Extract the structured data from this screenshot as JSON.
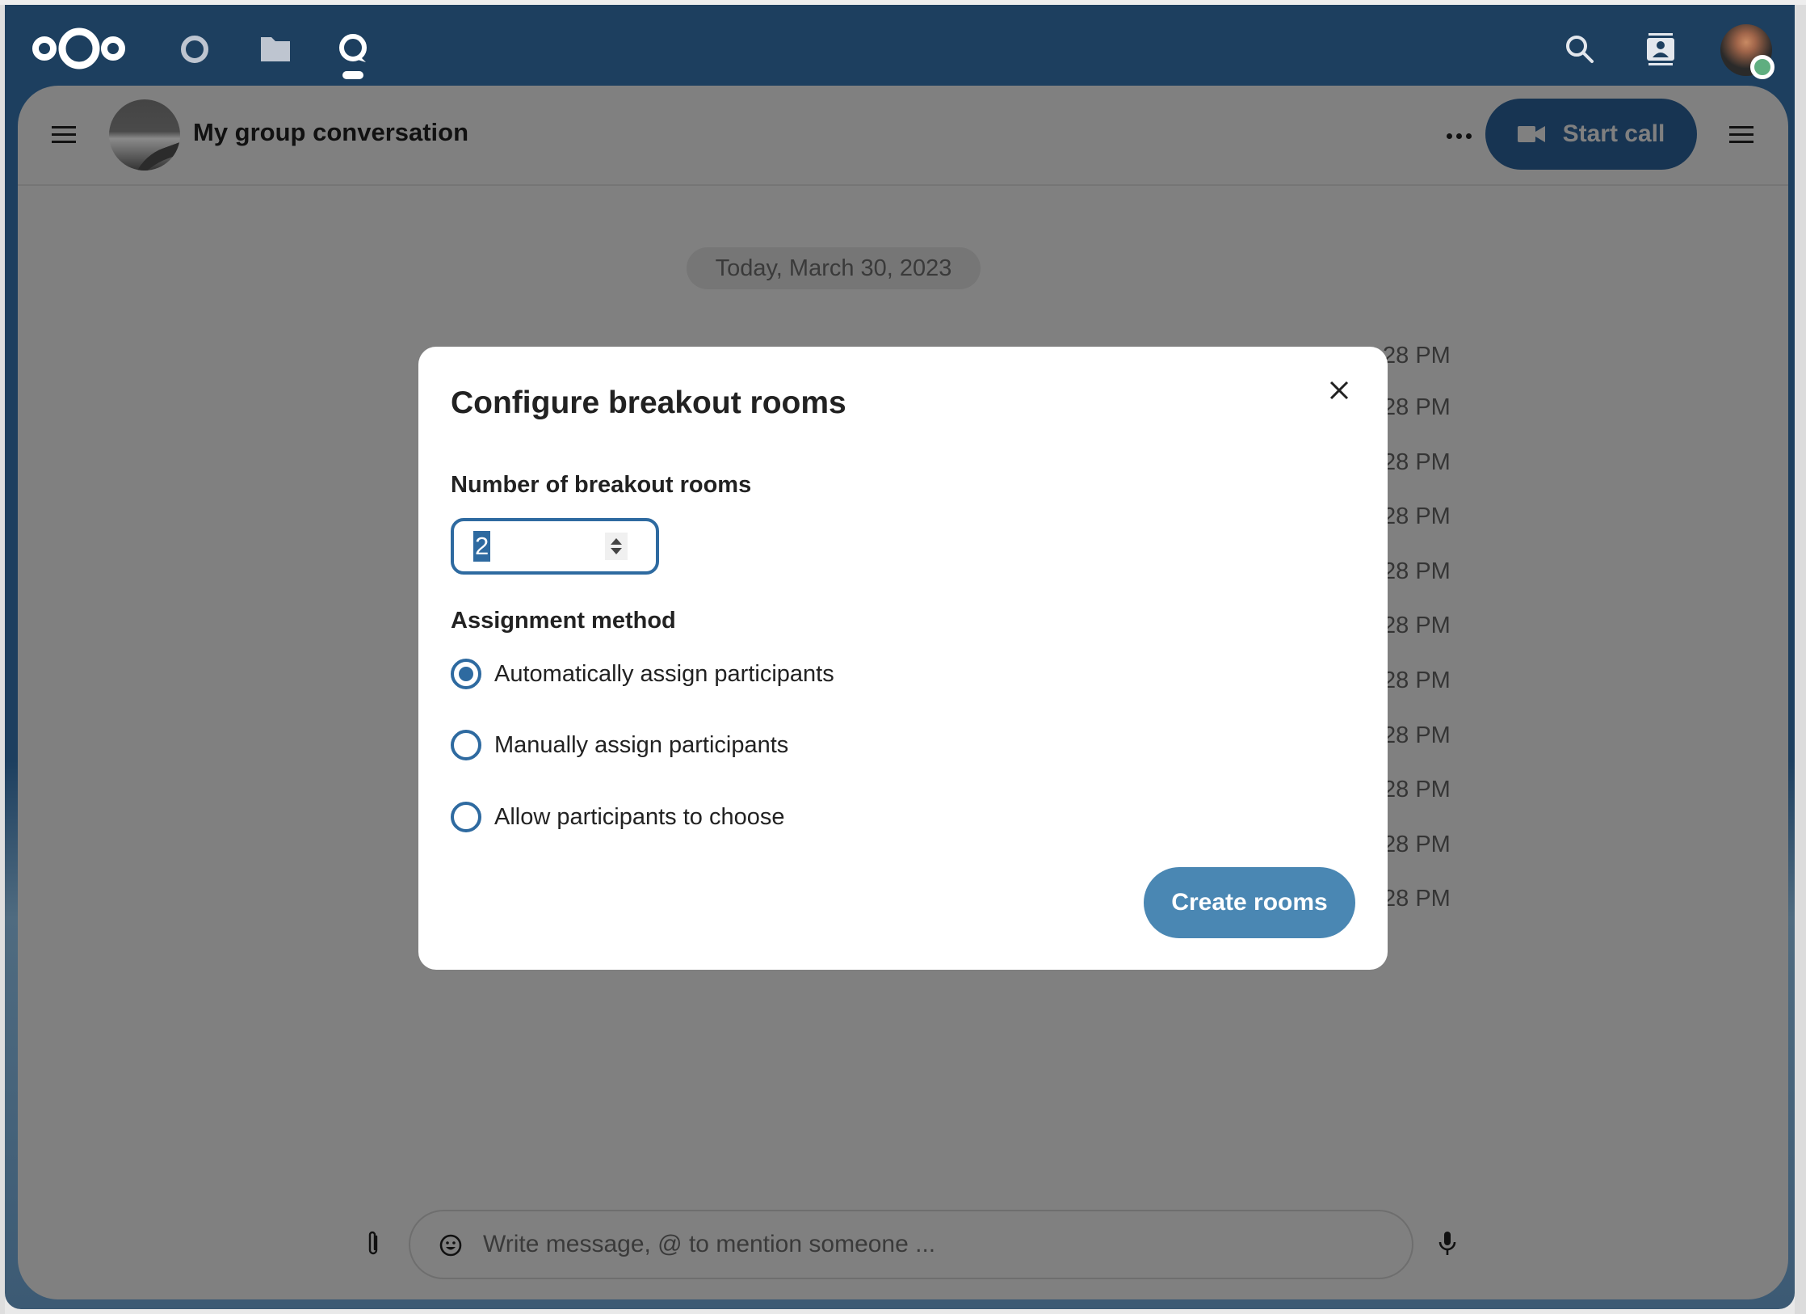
{
  "topbar": {
    "apps": [
      {
        "name": "dashboard",
        "icon": "circle-icon"
      },
      {
        "name": "files",
        "icon": "folder-icon"
      },
      {
        "name": "talk",
        "icon": "talk-icon",
        "active": true
      }
    ],
    "right": [
      {
        "name": "search",
        "icon": "search-icon"
      },
      {
        "name": "contacts",
        "icon": "contacts-icon"
      }
    ],
    "user_status": "online",
    "colors": {
      "header": "#1d3f5f",
      "status_online": "#5fae80"
    }
  },
  "conversation": {
    "title": "My group conversation",
    "more_label": "More actions",
    "start_call_label": "Start call",
    "date_separator": "Today, March 30, 2023",
    "message_times": [
      "28 PM",
      "28 PM",
      "28 PM",
      "28 PM",
      "28 PM",
      "28 PM",
      "28 PM",
      "28 PM",
      "28 PM",
      "28 PM",
      "28 PM"
    ]
  },
  "composer": {
    "placeholder": "Write message, @ to mention someone ..."
  },
  "modal": {
    "title": "Configure breakout rooms",
    "rooms_label": "Number of breakout rooms",
    "rooms_value": "2",
    "method_label": "Assignment method",
    "options": [
      {
        "label": "Automatically assign participants",
        "selected": true
      },
      {
        "label": "Manually assign participants",
        "selected": false
      },
      {
        "label": "Allow participants to choose",
        "selected": false
      }
    ],
    "create_label": "Create rooms",
    "colors": {
      "primary": "#2e6aa0",
      "button": "#4a87b3"
    }
  }
}
